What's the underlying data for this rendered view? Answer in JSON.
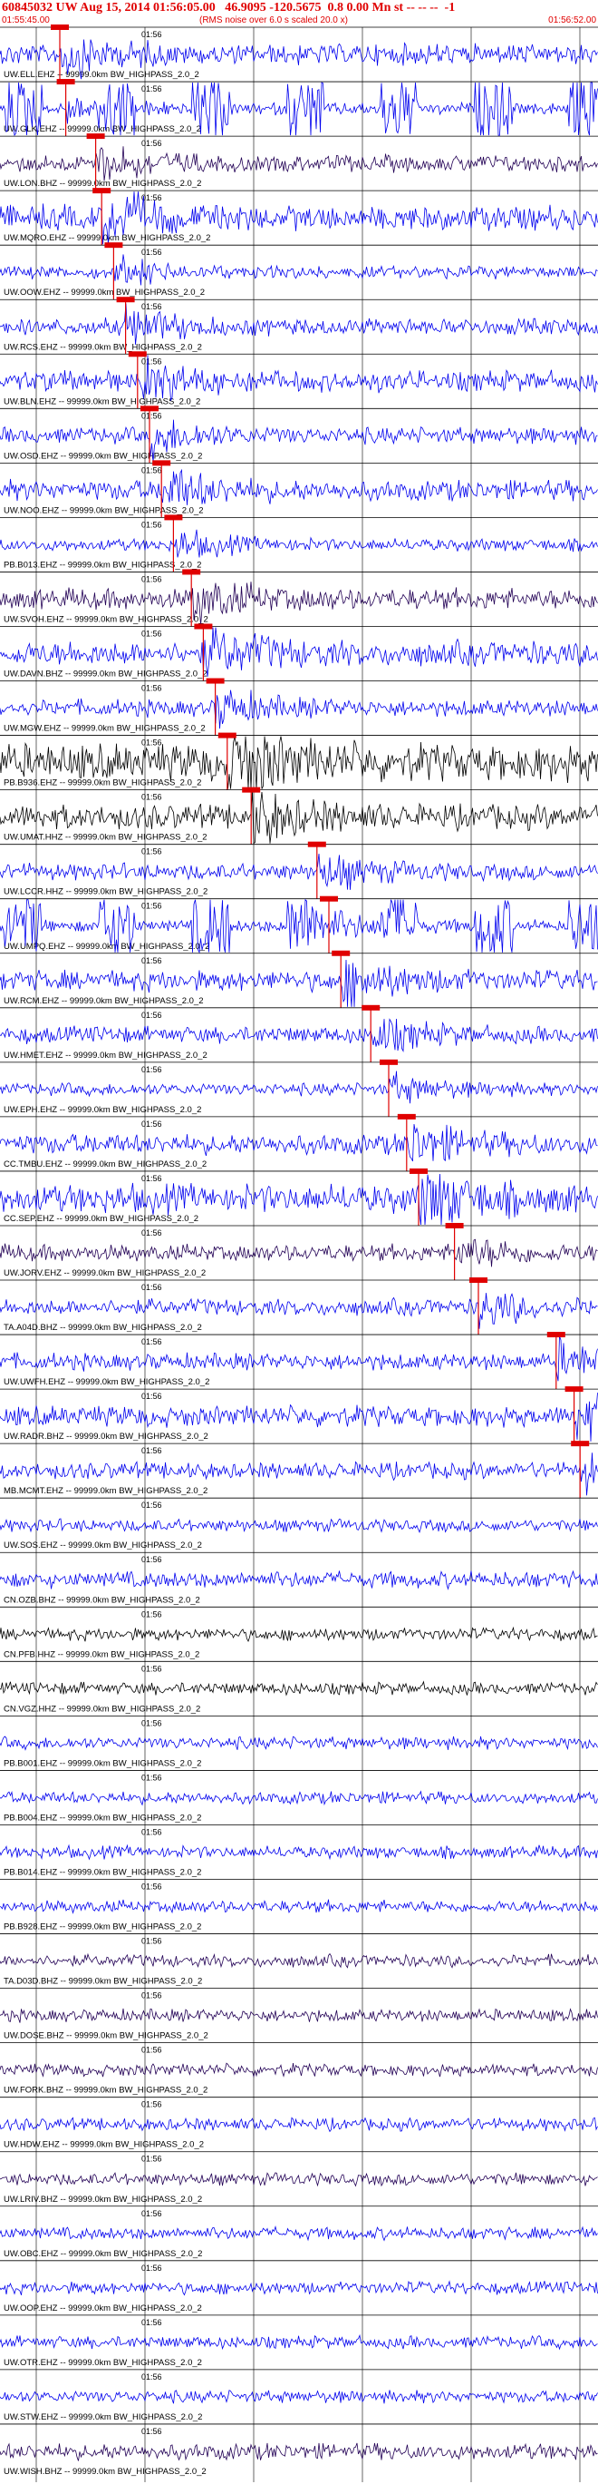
{
  "header": {
    "title": "60845032 UW Aug 15, 2014 01:56:05.00   46.9095 -120.5675  0.8 0.00 Mn st -- -- --  -1",
    "start_time": "01:55:45.00",
    "end_time": "01:56:52.00",
    "note": "(RMS noise over 6.0 s scaled 20.0 x)"
  },
  "colors": {
    "header": "#e00000",
    "pick": "#e00000",
    "blue": "#0000ee",
    "black": "#000000",
    "purple": "#220055"
  },
  "minute_label": "01:56",
  "chart_data": {
    "type": "line",
    "title": "60845032 UW Aug 15, 2014 01:56:05.00   46.9095 -120.5675  0.8 0.00 Mn st -- -- --  -1",
    "x_range": [
      "01:55:45.00",
      "01:56:52.00"
    ],
    "x_tick_label": "01:56",
    "grid": true,
    "series": [
      {
        "name": "UW.ELL.EHZ -- 99999.0km BW_HIGHPASS_2.0_2",
        "color": "blue",
        "amp": 0.5,
        "burst": 0,
        "pick": 0.1
      },
      {
        "name": "UW.GLK.EHZ -- 99999.0km BW_HIGHPASS_2.0_2",
        "color": "blue",
        "amp": 0.3,
        "burst": 1,
        "pick": 0.11
      },
      {
        "name": "UW.LON.BHZ -- 99999.0km BW_HIGHPASS_2.0_2",
        "color": "purple",
        "amp": 0.4,
        "burst": 0,
        "pick": 0.16
      },
      {
        "name": "UW.MQRO.EHZ -- 99999.0km BW_HIGHPASS_2.0_2",
        "color": "blue",
        "amp": 0.6,
        "burst": 0,
        "pick": 0.17
      },
      {
        "name": "UW.OOW.EHZ -- 99999.0km BW_HIGHPASS_2.0_2",
        "color": "blue",
        "amp": 0.3,
        "burst": 0,
        "pick": 0.19
      },
      {
        "name": "UW.RCS.EHZ -- 99999.0km BW_HIGHPASS_2.0_2",
        "color": "blue",
        "amp": 0.4,
        "burst": 0,
        "pick": 0.21
      },
      {
        "name": "UW.BLN.EHZ -- 99999.0km BW_HIGHPASS_2.0_2",
        "color": "blue",
        "amp": 0.5,
        "burst": 0,
        "pick": 0.23
      },
      {
        "name": "UW.OSD.EHZ -- 99999.0km BW_HIGHPASS_2.0_2",
        "color": "blue",
        "amp": 0.4,
        "burst": 0,
        "pick": 0.25
      },
      {
        "name": "UW.NOO.EHZ -- 99999.0km BW_HIGHPASS_2.0_2",
        "color": "blue",
        "amp": 0.5,
        "burst": 0,
        "pick": 0.27
      },
      {
        "name": "PB.B013.EHZ -- 99999.0km BW_HIGHPASS_2.0_2",
        "color": "blue",
        "amp": 0.3,
        "burst": 0,
        "pick": 0.29
      },
      {
        "name": "UW.SVOH.EHZ -- 99999.0km BW_HIGHPASS_2.0_2",
        "color": "purple",
        "amp": 0.5,
        "burst": 0,
        "pick": 0.32
      },
      {
        "name": "UW.DAVN.BHZ -- 99999.0km BW_HIGHPASS_2.0_2",
        "color": "blue",
        "amp": 0.6,
        "burst": 0,
        "pick": 0.34
      },
      {
        "name": "UW.MGW.EHZ -- 99999.0km BW_HIGHPASS_2.0_2",
        "color": "blue",
        "amp": 0.4,
        "burst": 0,
        "pick": 0.36
      },
      {
        "name": "PB.B936.EHZ -- 99999.0km BW_HIGHPASS_2.0_2",
        "color": "black",
        "amp": 0.9,
        "burst": 0,
        "pick": 0.38
      },
      {
        "name": "UW.UMAT.HHZ -- 99999.0km BW_HIGHPASS_2.0_2",
        "color": "black",
        "amp": 0.6,
        "burst": 0,
        "pick": 0.42
      },
      {
        "name": "UW.LCCR.HHZ -- 99999.0km BW_HIGHPASS_2.0_2",
        "color": "blue",
        "amp": 0.4,
        "burst": 0,
        "pick": 0.53
      },
      {
        "name": "UW.UMPQ.EHZ -- 99999.0km BW_HIGHPASS_2.0_2",
        "color": "blue",
        "amp": 0.3,
        "burst": 1,
        "pick": 0.55
      },
      {
        "name": "UW.RCM.EHZ -- 99999.0km BW_HIGHPASS_2.0_2",
        "color": "blue",
        "amp": 0.5,
        "burst": 0,
        "pick": 0.57
      },
      {
        "name": "UW.HMET.EHZ -- 99999.0km BW_HIGHPASS_2.0_2",
        "color": "blue",
        "amp": 0.4,
        "burst": 0,
        "pick": 0.62
      },
      {
        "name": "UW.EPH.EHZ -- 99999.0km BW_HIGHPASS_2.0_2",
        "color": "blue",
        "amp": 0.3,
        "burst": 0,
        "pick": 0.65
      },
      {
        "name": "CC.TMBU.EHZ -- 99999.0km BW_HIGHPASS_2.0_2",
        "color": "blue",
        "amp": 0.5,
        "burst": 0,
        "pick": 0.68
      },
      {
        "name": "CC.SEP.EHZ -- 99999.0km BW_HIGHPASS_2.0_2",
        "color": "blue",
        "amp": 0.7,
        "burst": 0,
        "pick": 0.7
      },
      {
        "name": "UW.JORV.EHZ -- 99999.0km BW_HIGHPASS_2.0_2",
        "color": "purple",
        "amp": 0.4,
        "burst": 0,
        "pick": 0.76
      },
      {
        "name": "TA.A04D.BHZ -- 99999.0km BW_HIGHPASS_2.0_2",
        "color": "blue",
        "amp": 0.4,
        "burst": 0,
        "pick": 0.8
      },
      {
        "name": "UW.UWFH.EHZ -- 99999.0km BW_HIGHPASS_2.0_2",
        "color": "blue",
        "amp": 0.4,
        "burst": 0,
        "pick": 0.93
      },
      {
        "name": "UW.RADR.BHZ -- 99999.0km BW_HIGHPASS_2.0_2",
        "color": "blue",
        "amp": 0.5,
        "burst": 0,
        "pick": 0.96
      },
      {
        "name": "MB.MCMT.EHZ -- 99999.0km BW_HIGHPASS_2.0_2",
        "color": "blue",
        "amp": 0.4,
        "burst": 0,
        "pick": 0.97
      },
      {
        "name": "UW.SOS.EHZ -- 99999.0km BW_HIGHPASS_2.0_2",
        "color": "blue",
        "amp": 0.3,
        "burst": 0,
        "pick": null
      },
      {
        "name": "CN.OZB.BHZ -- 99999.0km BW_HIGHPASS_2.0_2",
        "color": "blue",
        "amp": 0.4,
        "burst": 0,
        "pick": null
      },
      {
        "name": "CN.PFB.HHZ -- 99999.0km BW_HIGHPASS_2.0_2",
        "color": "black",
        "amp": 0.3,
        "burst": 0,
        "pick": null
      },
      {
        "name": "CN.VGZ.HHZ -- 99999.0km BW_HIGHPASS_2.0_2",
        "color": "black",
        "amp": 0.3,
        "burst": 0,
        "pick": null
      },
      {
        "name": "PB.B001.EHZ -- 99999.0km BW_HIGHPASS_2.0_2",
        "color": "blue",
        "amp": 0.3,
        "burst": 0,
        "pick": null
      },
      {
        "name": "PB.B004.EHZ -- 99999.0km BW_HIGHPASS_2.0_2",
        "color": "blue",
        "amp": 0.3,
        "burst": 0,
        "pick": null
      },
      {
        "name": "PB.B014.EHZ -- 99999.0km BW_HIGHPASS_2.0_2",
        "color": "blue",
        "amp": 0.3,
        "burst": 0,
        "pick": null
      },
      {
        "name": "PB.B928.EHZ -- 99999.0km BW_HIGHPASS_2.0_2",
        "color": "blue",
        "amp": 0.3,
        "burst": 0,
        "pick": null
      },
      {
        "name": "TA.D03D.BHZ -- 99999.0km BW_HIGHPASS_2.0_2",
        "color": "purple",
        "amp": 0.3,
        "burst": 0,
        "pick": null
      },
      {
        "name": "UW.DOSE.BHZ -- 99999.0km BW_HIGHPASS_2.0_2",
        "color": "purple",
        "amp": 0.3,
        "burst": 0,
        "pick": null
      },
      {
        "name": "UW.FORK.BHZ -- 99999.0km BW_HIGHPASS_2.0_2",
        "color": "purple",
        "amp": 0.3,
        "burst": 0,
        "pick": null
      },
      {
        "name": "UW.HDW.EHZ -- 99999.0km BW_HIGHPASS_2.0_2",
        "color": "blue",
        "amp": 0.3,
        "burst": 0,
        "pick": null
      },
      {
        "name": "UW.LRIV.BHZ -- 99999.0km BW_HIGHPASS_2.0_2",
        "color": "purple",
        "amp": 0.3,
        "burst": 0,
        "pick": null
      },
      {
        "name": "UW.OBC.EHZ -- 99999.0km BW_HIGHPASS_2.0_2",
        "color": "blue",
        "amp": 0.3,
        "burst": 0,
        "pick": null
      },
      {
        "name": "UW.OOP.EHZ -- 99999.0km BW_HIGHPASS_2.0_2",
        "color": "blue",
        "amp": 0.3,
        "burst": 0,
        "pick": null
      },
      {
        "name": "UW.OTR.EHZ -- 99999.0km BW_HIGHPASS_2.0_2",
        "color": "blue",
        "amp": 0.3,
        "burst": 0,
        "pick": null
      },
      {
        "name": "UW.STW.EHZ -- 99999.0km BW_HIGHPASS_2.0_2",
        "color": "blue",
        "amp": 0.3,
        "burst": 0,
        "pick": null
      },
      {
        "name": "UW.WISH.BHZ -- 99999.0km BW_HIGHPASS_2.0_2",
        "color": "purple",
        "amp": 0.4,
        "burst": 0,
        "pick": null
      }
    ]
  }
}
